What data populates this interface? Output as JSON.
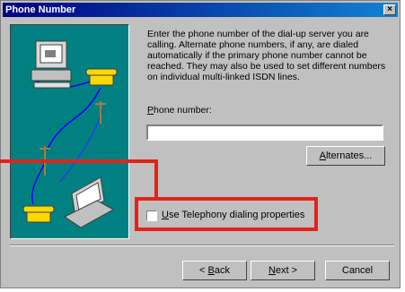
{
  "dialog": {
    "title": "Phone Number",
    "close_label": "×",
    "description": "Enter the phone number of the dial-up server you are calling.  Alternate phone numbers, if any, are dialed automatically if the primary phone number cannot be reached.  They may also be used to set different numbers on individual multi-linked ISDN lines.",
    "phone_label": "Phone number:",
    "phone_value": "",
    "alternates_label": "Alternates...",
    "telephony_label": "Use Telephony dialing properties",
    "telephony_checked": false,
    "back_label": "< Back",
    "next_label": "Next >",
    "cancel_label": "Cancel"
  },
  "colors": {
    "illustration_bg": "#008080",
    "highlight": "#e2231a",
    "titlebar": "#000080"
  },
  "icons": [
    "computer-icon",
    "telephone-icon",
    "utility-pole-icon",
    "laptop-icon",
    "close-icon"
  ]
}
